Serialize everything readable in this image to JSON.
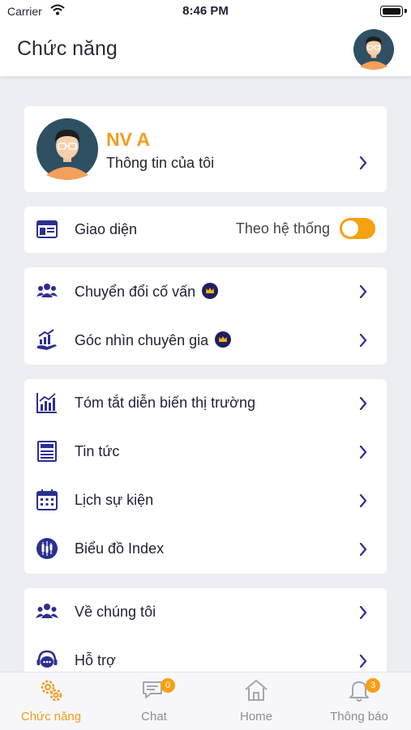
{
  "status_bar": {
    "carrier": "Carrier",
    "time": "8:46 PM"
  },
  "header": {
    "title": "Chức năng"
  },
  "profile": {
    "name": "NV A",
    "subtitle": "Thông tin của tôi"
  },
  "theme": {
    "label": "Giao diện",
    "value": "Theo hệ thống",
    "toggle_on": true
  },
  "group1": [
    {
      "label": "Chuyển đổi cố vấn",
      "premium": true,
      "icon": "users-icon"
    },
    {
      "label": "Góc nhìn chuyên gia",
      "premium": true,
      "icon": "growth-icon"
    }
  ],
  "group2": [
    {
      "label": "Tóm tắt diễn biến thị trường",
      "icon": "bar-chart-icon"
    },
    {
      "label": "Tin tức",
      "icon": "news-icon"
    },
    {
      "label": "Lịch sự kiện",
      "icon": "calendar-icon"
    },
    {
      "label": "Biểu đồ Index",
      "icon": "candlestick-icon"
    }
  ],
  "group3": [
    {
      "label": "Về chúng tôi",
      "icon": "team-icon"
    },
    {
      "label": "Hỗ trợ",
      "icon": "support-icon"
    }
  ],
  "tabs": [
    {
      "label": "Chức năng",
      "icon": "gears-icon",
      "active": true
    },
    {
      "label": "Chat",
      "icon": "chat-icon",
      "badge": "0"
    },
    {
      "label": "Home",
      "icon": "home-icon"
    },
    {
      "label": "Thông báo",
      "icon": "bell-icon",
      "badge": "3"
    }
  ],
  "colors": {
    "accent": "#f59b1d",
    "icon": "#2b2f8f",
    "background": "#eceef3"
  }
}
